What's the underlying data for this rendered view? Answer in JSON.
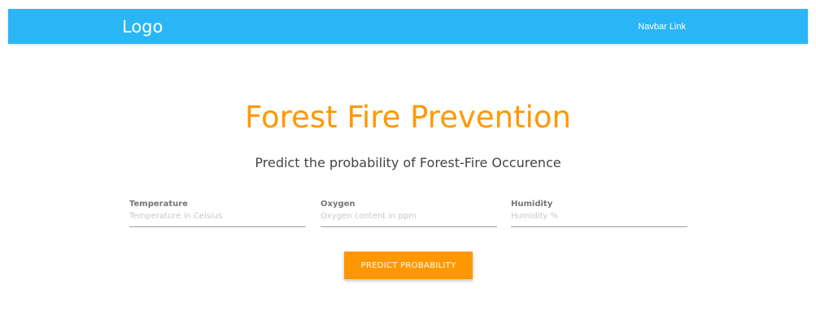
{
  "navbar": {
    "logo": "Logo",
    "link": "Navbar Link",
    "background_color": "#29b6f6"
  },
  "hero": {
    "title": "Forest Fire Prevention",
    "subtitle": "Predict the probability of Forest-Fire Occurence",
    "title_color": "#ff9800"
  },
  "form": {
    "fields": [
      {
        "label": "Temperature",
        "placeholder": "Temperature in Celsius",
        "value": ""
      },
      {
        "label": "Oxygen",
        "placeholder": "Oxygen content in ppm",
        "value": ""
      },
      {
        "label": "Humidity",
        "placeholder": "Humidity %",
        "value": ""
      }
    ],
    "submit_label": "Predict Probability",
    "button_color": "#ff9800"
  }
}
